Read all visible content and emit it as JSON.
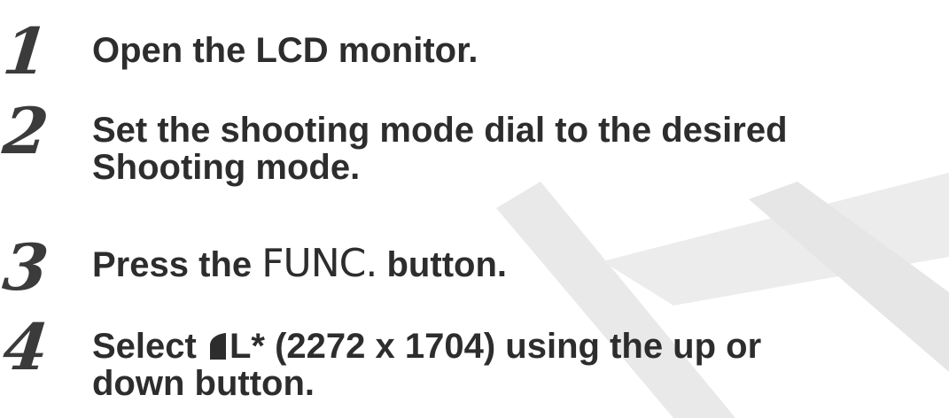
{
  "steps": [
    {
      "number": "1",
      "text": "Open the LCD monitor."
    },
    {
      "number": "2",
      "line1": "Set the shooting mode dial to the desired",
      "line2": "Shooting mode."
    },
    {
      "number": "3",
      "before": "Press the",
      "key": "FUNC.",
      "after": "button."
    },
    {
      "number": "4",
      "before": "Select",
      "icon": "image-size-large-icon",
      "after": "L* (2272 x 1704) using the up or",
      "line2": "down button."
    }
  ],
  "colors": {
    "text": "#2d2d2d",
    "number": "#3b3b3b",
    "watermark": "#e8e8e8"
  }
}
